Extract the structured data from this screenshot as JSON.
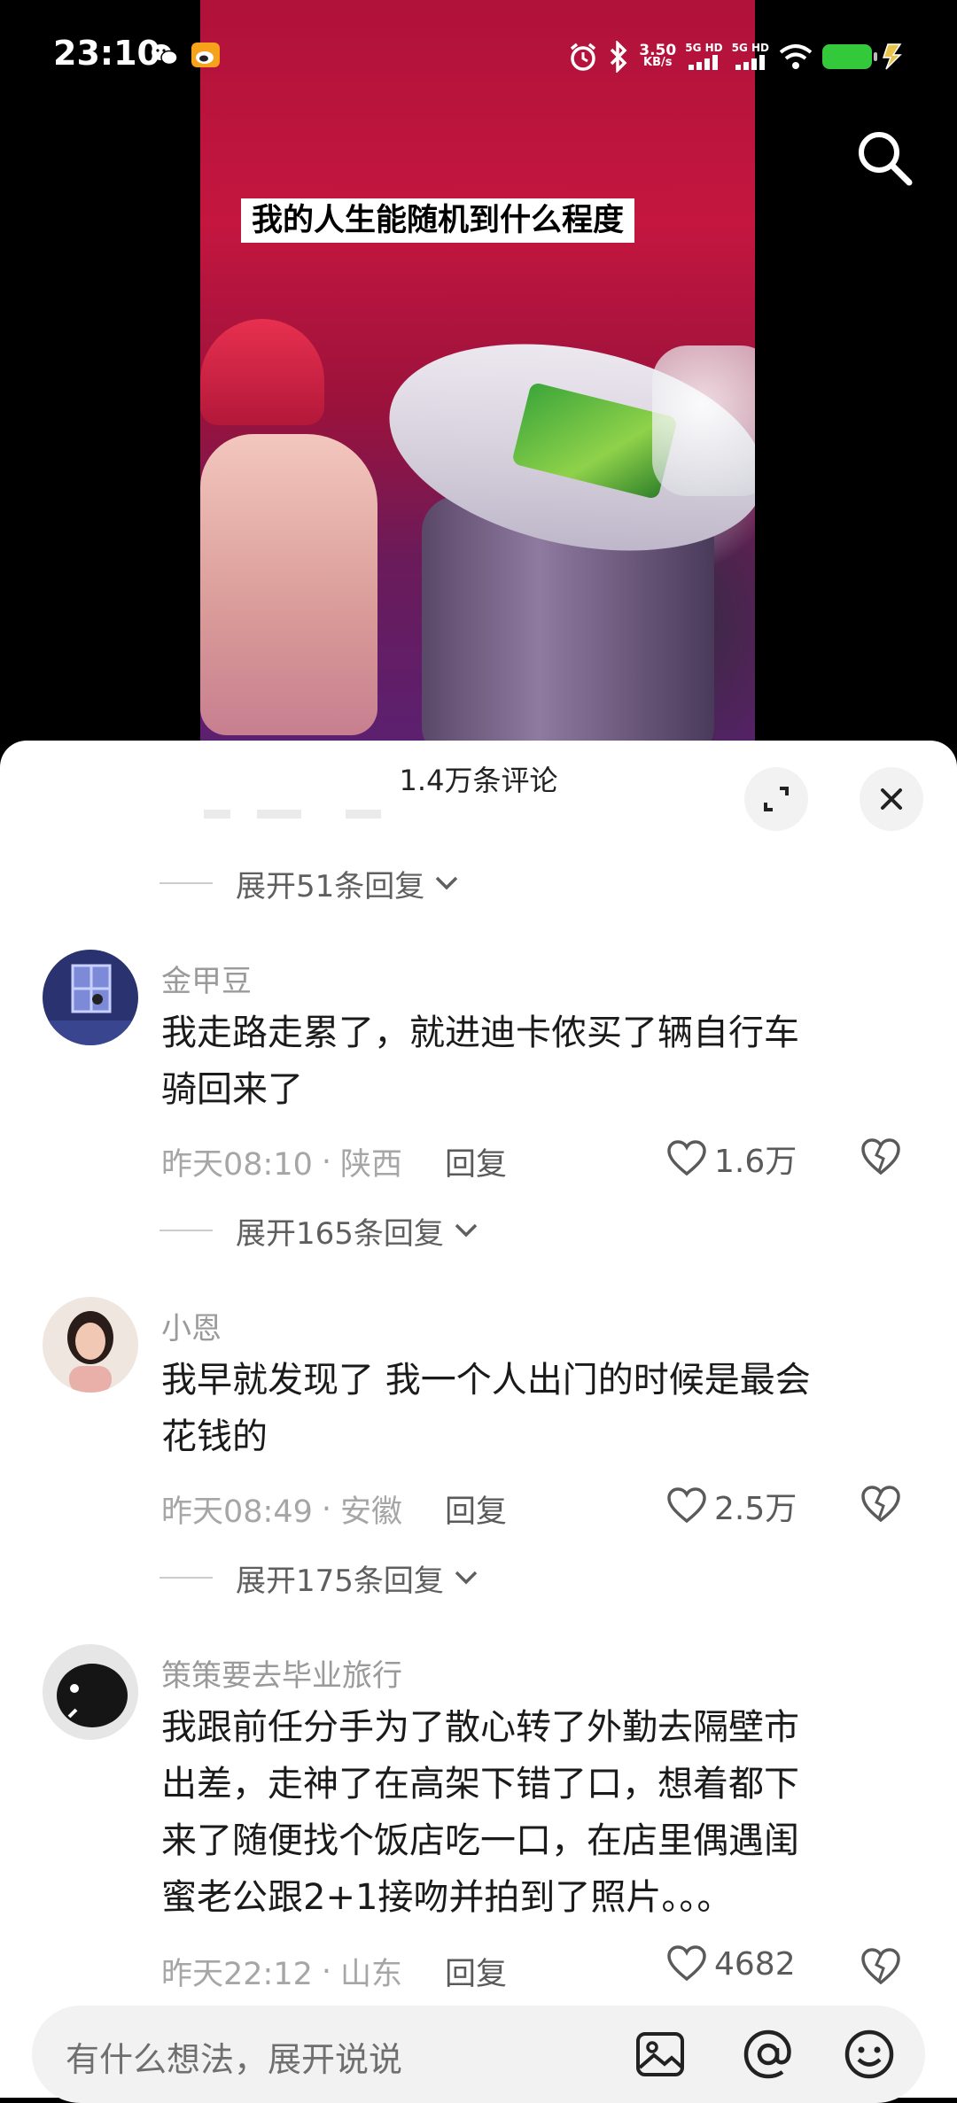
{
  "status_bar": {
    "time": "23:10",
    "net_speed_value": "3.50",
    "net_speed_unit": "KB/s",
    "sim1": "5G HD",
    "sim2": "5G HD",
    "icons": [
      "wechat-icon",
      "weibo-icon",
      "alarm-icon",
      "bluetooth-icon",
      "signal-icon",
      "wifi-icon",
      "battery-icon",
      "charging-icon"
    ]
  },
  "video": {
    "caption": "我的人生能随机到什么程度"
  },
  "comments_panel": {
    "title": "1.4万条评论",
    "expand_icon": "expand-icon",
    "close_icon": "close-icon"
  },
  "expand_replies": [
    {
      "label": "展开51条回复"
    },
    {
      "label": "展开165条回复"
    },
    {
      "label": "展开175条回复"
    }
  ],
  "comments": [
    {
      "username": "金甲豆",
      "line1": "我走路走累了，就进迪卡侬买了辆自行车",
      "line2": "骑回来了",
      "time": "昨天08:10",
      "location": "陕西",
      "reply_label": "回复",
      "likes": "1.6万"
    },
    {
      "username": "小恩",
      "line1": "我早就发现了 我一个人出门的时候是最会",
      "line2": "花钱的",
      "time": "昨天08:49",
      "location": "安徽",
      "reply_label": "回复",
      "likes": "2.5万"
    },
    {
      "username": "策策要去毕业旅行",
      "line1": "我跟前任分手为了散心转了外勤去隔壁市",
      "line2": "出差，走神了在高架下错了口，想着都下",
      "line3": "来了随便找个饭店吃一口，在店里偶遇闺",
      "line4": "蜜老公跟2+1接吻并拍到了照片。。。",
      "time": "昨天22:12",
      "location": "山东",
      "reply_label": "回复",
      "likes": "4682"
    }
  ],
  "input": {
    "placeholder": "有什么想法，展开说说",
    "icons": [
      "image-icon",
      "mention-icon",
      "emoji-icon"
    ]
  },
  "colors": {
    "battery": "#33c93b",
    "text_primary": "#1a1a1a",
    "text_secondary": "#9a9a9a"
  }
}
